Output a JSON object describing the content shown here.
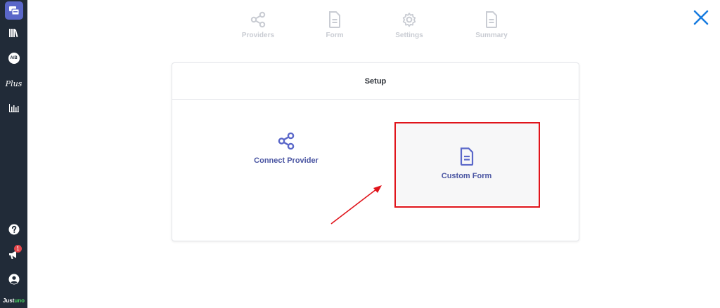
{
  "sidebar": {
    "plus_label": "Plus",
    "ab_label": "A/B",
    "notification_count": "1",
    "brand_prefix": "Just",
    "brand_suffix": "uno"
  },
  "steps": [
    {
      "label": "Providers"
    },
    {
      "label": "Form"
    },
    {
      "label": "Settings"
    },
    {
      "label": "Summary"
    }
  ],
  "card": {
    "title": "Setup",
    "options": [
      {
        "label": "Connect Provider",
        "icon": "share-icon"
      },
      {
        "label": "Custom Form",
        "icon": "document-icon"
      }
    ]
  },
  "colors": {
    "sidebar_bg": "#212b38",
    "accent": "#5a67c9",
    "option_text": "#4a55a2",
    "close": "#1a7de0",
    "annotation_red": "#e0141b"
  }
}
